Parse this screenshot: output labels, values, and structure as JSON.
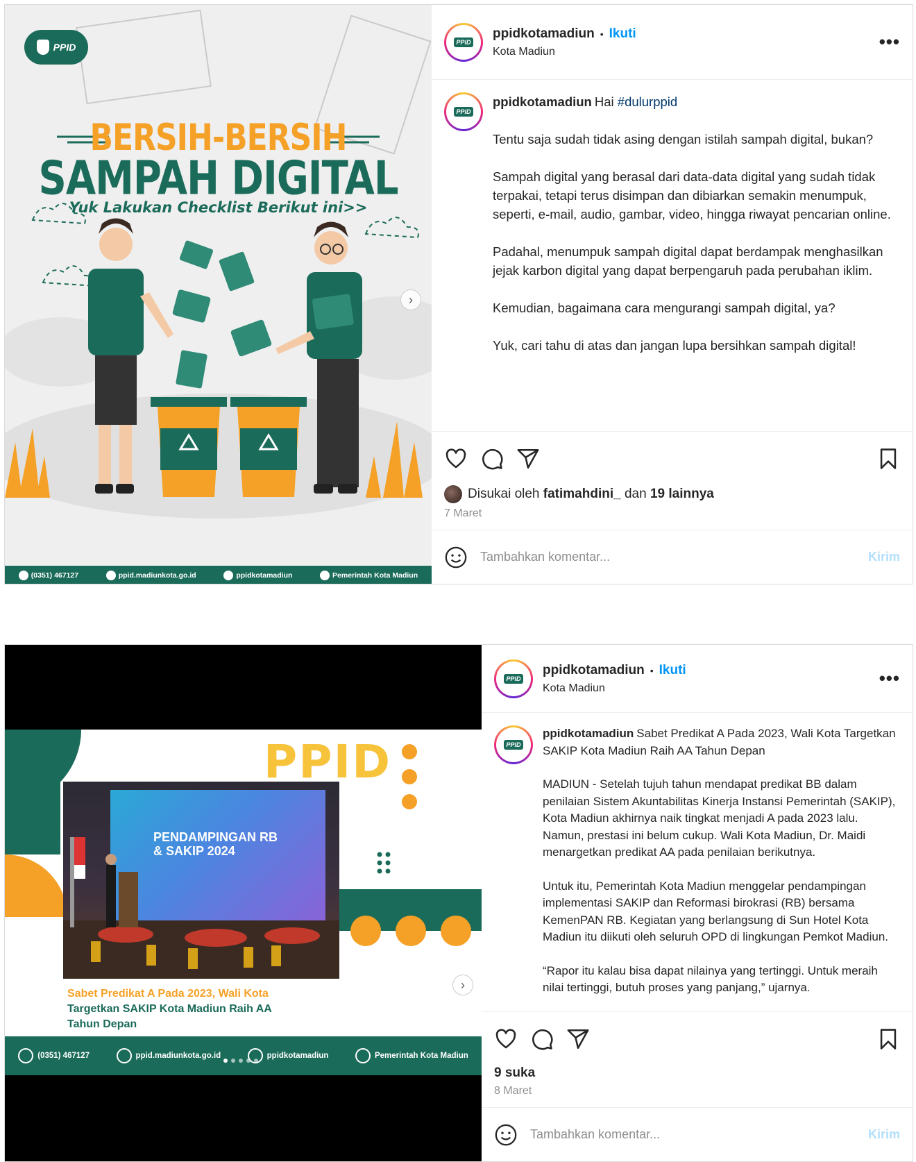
{
  "posts": [
    {
      "username": "ppidkotamadiun",
      "follow_label": "Ikuti",
      "separator": "•",
      "location": "Kota Madiun",
      "more_label": "•••",
      "avatar_text": "PPID",
      "caption_lead": "Hai",
      "caption_hashtag": "#dulurppid",
      "caption_paragraphs": [
        "Tentu saja sudah tidak asing dengan istilah sampah digital, bukan?",
        "Sampah digital yang berasal dari data-data digital yang sudah tidak terpakai, tetapi terus disimpan dan dibiarkan semakin menumpuk, seperti, e-mail, audio, gambar, video, hingga riwayat pencarian online.",
        "Padahal, menumpuk sampah digital dapat berdampak menghasilkan jejak karbon digital yang dapat berpengaruh pada perubahan iklim.",
        "Kemudian, bagaimana cara mengurangi sampah digital, ya?",
        "Yuk, cari tahu di atas dan jangan lupa bersihkan sampah digital!"
      ],
      "likes_prefix": "Disukai oleh",
      "likes_user": "fatimahdini_",
      "likes_mid": "dan",
      "likes_rest": "19 lainnya",
      "date": "7 Maret",
      "comment_placeholder": "Tambahkan komentar...",
      "send_label": "Kirim",
      "media": {
        "logo_text": "PPID",
        "title_line1": "BERSIH-BERSIH",
        "title_line2": "SAMPAH DIGITAL",
        "subtitle": "Yuk Lakukan Checklist Berikut ini>>",
        "footer": {
          "phone": "(0351) 467127",
          "web": "ppid.madiunkota.go.id",
          "instagram": "ppidkotamadiun",
          "facebook": "Pemerintah Kota Madiun"
        }
      }
    },
    {
      "username": "ppidkotamadiun",
      "follow_label": "Ikuti",
      "separator": "•",
      "location": "Kota Madiun",
      "more_label": "•••",
      "avatar_text": "PPID",
      "caption_lead": "Sabet Predikat A Pada 2023, Wali Kota Targetkan SAKIP Kota Madiun Raih AA Tahun Depan",
      "caption_paragraphs": [
        "MADIUN - Setelah tujuh tahun mendapat predikat BB dalam penilaian Sistem Akuntabilitas Kinerja Instansi Pemerintah (SAKIP), Kota Madiun akhirnya naik tingkat menjadi A pada 2023 lalu. Namun, prestasi ini belum cukup. Wali Kota Madiun, Dr. Maidi menargetkan predikat AA pada penilaian berikutnya.",
        "Untuk itu, Pemerintah Kota Madiun menggelar pendampingan implementasi SAKIP dan Reformasi birokrasi (RB) bersama KemenPAN RB. Kegiatan yang berlangsung di Sun Hotel Kota Madiun itu diikuti oleh seluruh OPD di lingkungan Pemkot Madiun.",
        "“Rapor itu kalau bisa dapat nilainya yang tertinggi. Untuk meraih nilai tertinggi, butuh proses yang panjang,” ujarnya."
      ],
      "likes_text": "9 suka",
      "date": "8 Maret",
      "comment_placeholder": "Tambahkan komentar...",
      "send_label": "Kirim",
      "media": {
        "brand": "PPID",
        "screen_title": "PENDAMPINGAN RB & SAKIP 2024",
        "slide_title_orange": "Sabet Predikat A Pada 2023, Wali Kota",
        "slide_title_green1": "Targetkan SAKIP Kota Madiun Raih AA",
        "slide_title_green2": "Tahun Depan",
        "footer": {
          "phone": "(0351) 467127",
          "web": "ppid.madiunkota.go.id",
          "instagram": "ppidkotamadiun",
          "facebook": "Pemerintah Kota Madiun"
        }
      }
    }
  ],
  "colors": {
    "brand_green": "#1b6b5a",
    "brand_orange": "#f5a026",
    "follow_blue": "#0095f6",
    "hashtag_blue": "#00376b"
  }
}
